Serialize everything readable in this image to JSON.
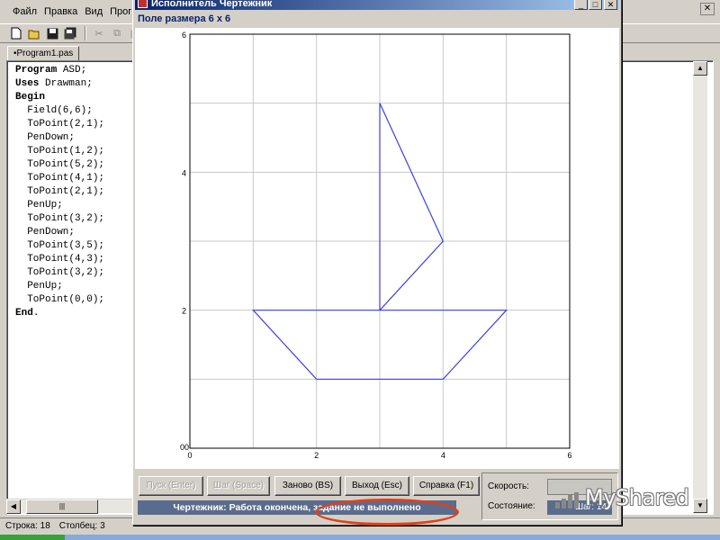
{
  "ide": {
    "menu": [
      "Файл",
      "Правка",
      "Вид",
      "Програм"
    ],
    "file_tab": "•Program1.pas",
    "code_lines": [
      {
        "kw": "Program",
        "rest": " ASD;"
      },
      {
        "kw": "Uses",
        "rest": " Drawman;"
      },
      {
        "kw": "Begin",
        "rest": ""
      },
      {
        "kw": "",
        "rest": "  Field(6,6);"
      },
      {
        "kw": "",
        "rest": "  ToPoint(2,1);"
      },
      {
        "kw": "",
        "rest": "  PenDown;"
      },
      {
        "kw": "",
        "rest": "  ToPoint(1,2);"
      },
      {
        "kw": "",
        "rest": "  ToPoint(5,2);"
      },
      {
        "kw": "",
        "rest": "  ToPoint(4,1);"
      },
      {
        "kw": "",
        "rest": "  ToPoint(2,1);"
      },
      {
        "kw": "",
        "rest": "  PenUp;"
      },
      {
        "kw": "",
        "rest": "  ToPoint(3,2);"
      },
      {
        "kw": "",
        "rest": "  PenDown;"
      },
      {
        "kw": "",
        "rest": "  ToPoint(3,5);"
      },
      {
        "kw": "",
        "rest": "  ToPoint(4,3);"
      },
      {
        "kw": "",
        "rest": "  ToPoint(3,2);"
      },
      {
        "kw": "",
        "rest": "  PenUp;"
      },
      {
        "kw": "",
        "rest": "  ToPoint(0,0);"
      },
      {
        "kw": "End",
        "rest": "."
      }
    ],
    "status_line": "Строка: 18",
    "status_col": "Столбец: 3"
  },
  "drawman": {
    "title": "Исполнитель Чертежник",
    "field_info": "Поле размера 6 x 6",
    "buttons": {
      "run": "Пуск (Enter)",
      "step": "Шаг (Space)",
      "restart": "Заново (BS)",
      "exit": "Выход (Esc)",
      "help": "Справка (F1)"
    },
    "status_message": "Чертежник: Работа окончена, задание не выполнено",
    "speed_label": "Скорость:",
    "state_label": "Состояние:",
    "state_value": "Шаг: 14",
    "accent_color": "#4040e0",
    "highlight_color": "#e0401a"
  },
  "watermark": "MyShared",
  "chart_data": {
    "type": "line",
    "xlim": [
      0,
      6
    ],
    "ylim": [
      0,
      6
    ],
    "x_tick_labels": [
      "0",
      "2",
      "4",
      "6"
    ],
    "y_tick_labels": [
      "0",
      "2",
      "4",
      "6"
    ],
    "origin_labels": [
      "00"
    ],
    "grid": true,
    "series": [
      {
        "points": [
          [
            2,
            1
          ],
          [
            1,
            2
          ],
          [
            5,
            2
          ],
          [
            4,
            1
          ],
          [
            2,
            1
          ]
        ]
      },
      {
        "points": [
          [
            3,
            2
          ],
          [
            3,
            5
          ],
          [
            4,
            3
          ],
          [
            3,
            2
          ]
        ]
      }
    ]
  }
}
